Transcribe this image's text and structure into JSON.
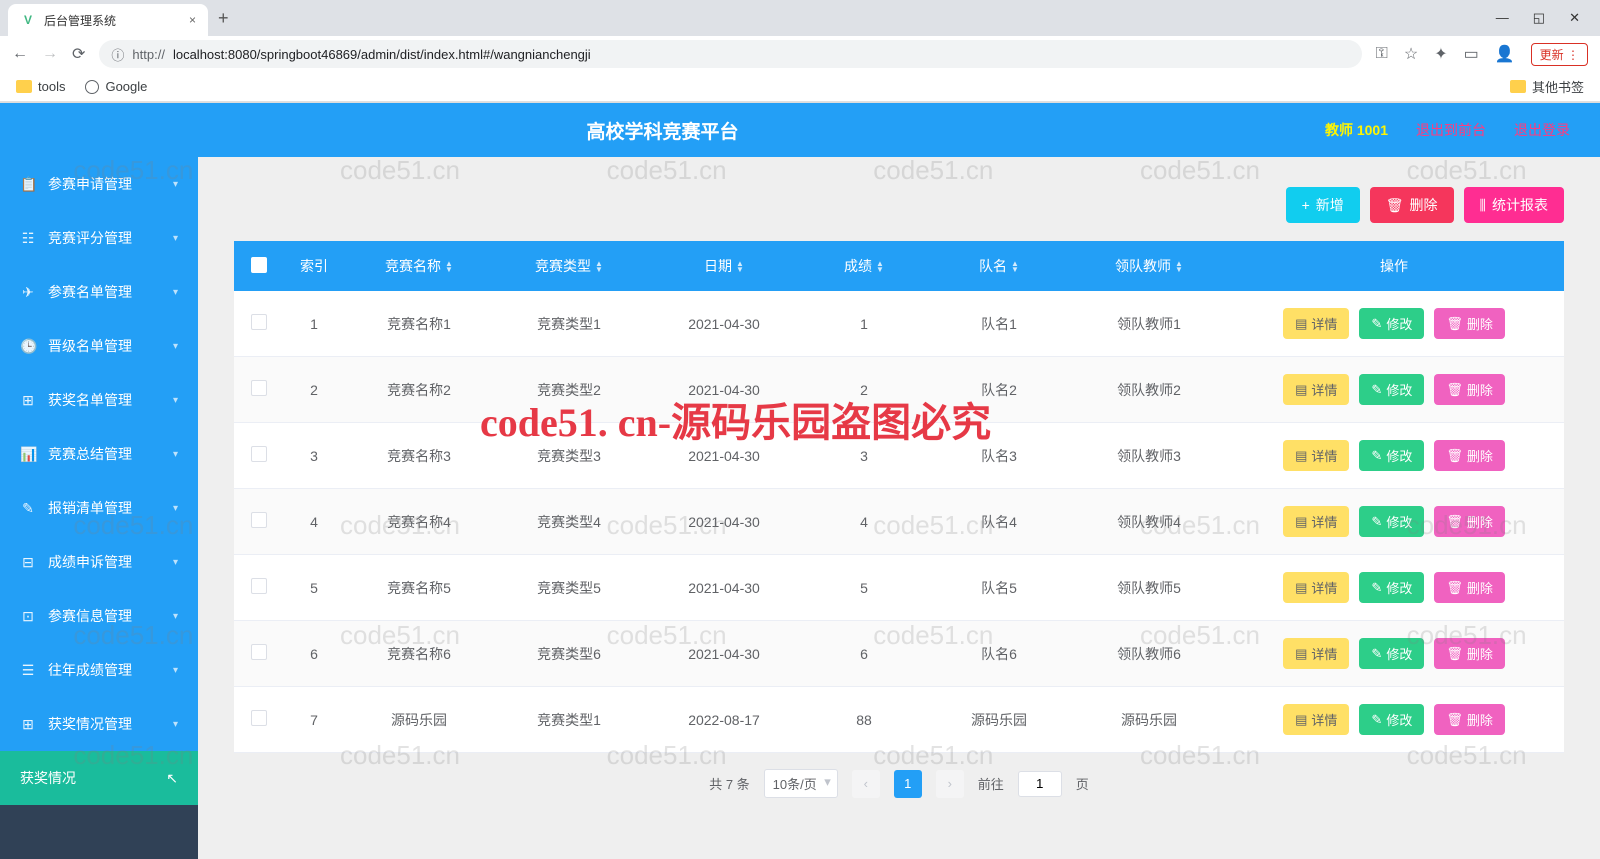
{
  "browser": {
    "tab_title": "后台管理系统",
    "url_prefix": "http://",
    "url": "localhost:8080/springboot46869/admin/dist/index.html#/wangnianchengji",
    "update_label": "更新",
    "bookmarks": {
      "tools": "tools",
      "google": "Google",
      "other": "其他书签"
    }
  },
  "header": {
    "title": "高校学科竞赛平台",
    "user": "教师 1001",
    "exit_front": "退出到前台",
    "logout": "退出登录"
  },
  "sidebar": {
    "items": [
      {
        "label": "参赛申请管理",
        "icon": "📋"
      },
      {
        "label": "竞赛评分管理",
        "icon": "☷"
      },
      {
        "label": "参赛名单管理",
        "icon": "✈"
      },
      {
        "label": "晋级名单管理",
        "icon": "🕒"
      },
      {
        "label": "获奖名单管理",
        "icon": "⊞"
      },
      {
        "label": "竞赛总结管理",
        "icon": "📊"
      },
      {
        "label": "报销清单管理",
        "icon": "✎"
      },
      {
        "label": "成绩申诉管理",
        "icon": "⊟"
      },
      {
        "label": "参赛信息管理",
        "icon": "⊡"
      },
      {
        "label": "往年成绩管理",
        "icon": "☰"
      },
      {
        "label": "获奖情况管理",
        "icon": "⊞"
      }
    ],
    "active": "获奖情况"
  },
  "toolbar": {
    "add": "新增",
    "delete": "删除",
    "stats": "统计报表"
  },
  "table": {
    "columns": {
      "index": "索引",
      "name": "竞赛名称",
      "type": "竞赛类型",
      "date": "日期",
      "score": "成绩",
      "team": "队名",
      "teacher": "领队教师",
      "ops": "操作"
    },
    "ops": {
      "detail": "详情",
      "edit": "修改",
      "delete": "删除"
    },
    "rows": [
      {
        "idx": "1",
        "name": "竞赛名称1",
        "type": "竞赛类型1",
        "date": "2021-04-30",
        "score": "1",
        "team": "队名1",
        "teacher": "领队教师1"
      },
      {
        "idx": "2",
        "name": "竞赛名称2",
        "type": "竞赛类型2",
        "date": "2021-04-30",
        "score": "2",
        "team": "队名2",
        "teacher": "领队教师2"
      },
      {
        "idx": "3",
        "name": "竞赛名称3",
        "type": "竞赛类型3",
        "date": "2021-04-30",
        "score": "3",
        "team": "队名3",
        "teacher": "领队教师3"
      },
      {
        "idx": "4",
        "name": "竞赛名称4",
        "type": "竞赛类型4",
        "date": "2021-04-30",
        "score": "4",
        "team": "队名4",
        "teacher": "领队教师4"
      },
      {
        "idx": "5",
        "name": "竞赛名称5",
        "type": "竞赛类型5",
        "date": "2021-04-30",
        "score": "5",
        "team": "队名5",
        "teacher": "领队教师5"
      },
      {
        "idx": "6",
        "name": "竞赛名称6",
        "type": "竞赛类型6",
        "date": "2021-04-30",
        "score": "6",
        "team": "队名6",
        "teacher": "领队教师6"
      },
      {
        "idx": "7",
        "name": "源码乐园",
        "type": "竞赛类型1",
        "date": "2022-08-17",
        "score": "88",
        "team": "源码乐园",
        "teacher": "源码乐园"
      }
    ]
  },
  "pagination": {
    "total": "共 7 条",
    "pagesize": "10条/页",
    "current": "1",
    "goto_prefix": "前往",
    "goto_value": "1",
    "goto_suffix": "页"
  },
  "watermark": "code51.cn",
  "big_watermark": "code51. cn-源码乐园盗图必究"
}
